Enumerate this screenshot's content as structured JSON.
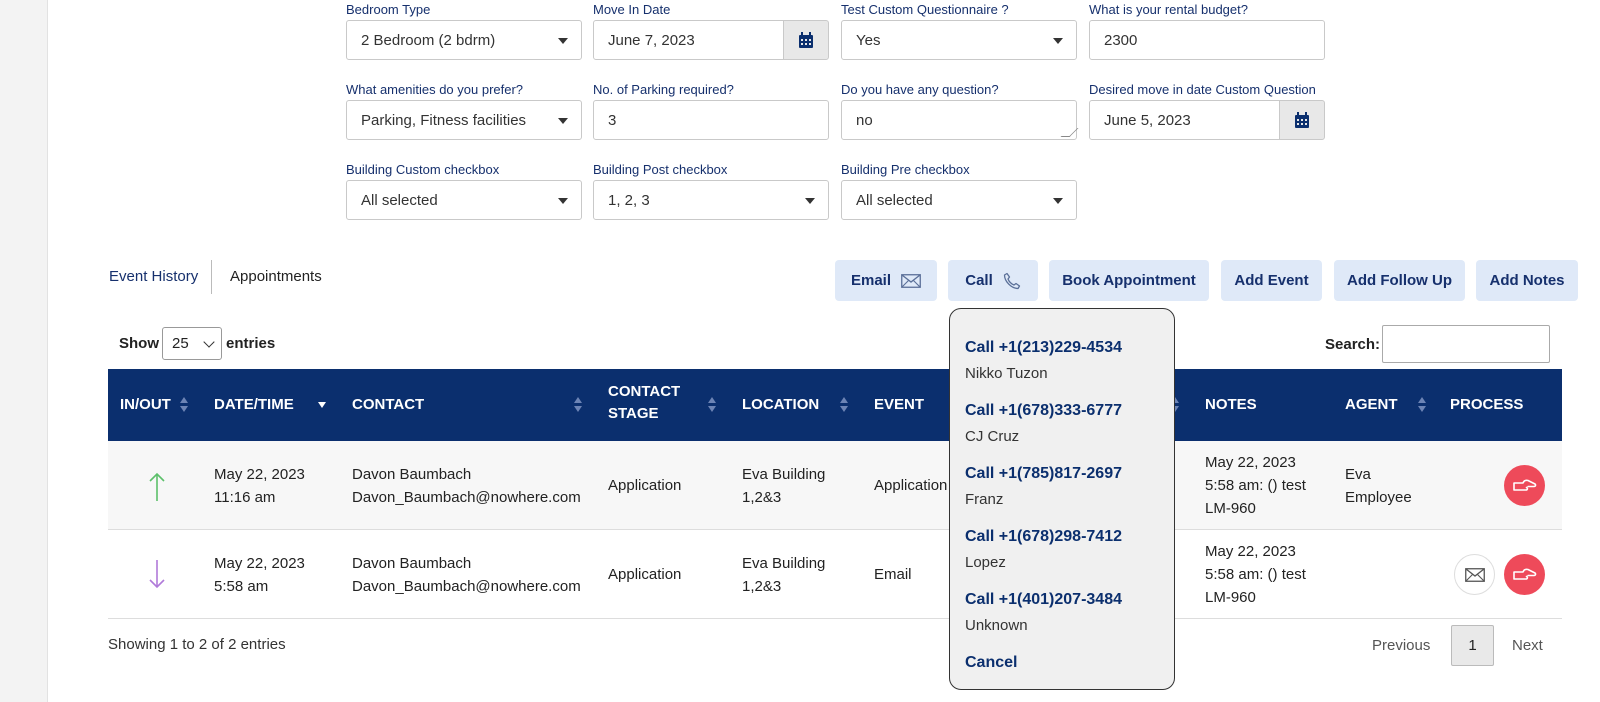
{
  "form": {
    "bedroom_type": {
      "label": "Bedroom Type",
      "value": "2 Bedroom (2 bdrm)"
    },
    "move_in_date": {
      "label": "Move In Date",
      "value": "June 7, 2023"
    },
    "test_questionnaire": {
      "label": "Test Custom Questionnaire ?",
      "value": "Yes"
    },
    "rental_budget": {
      "label": "What is your rental budget?",
      "value": "2300"
    },
    "amenities": {
      "label": "What amenities do you prefer?",
      "value": "Parking, Fitness facilities"
    },
    "parking": {
      "label": "No. of Parking required?",
      "value": "3"
    },
    "question": {
      "label": "Do you have any question?",
      "value": "no"
    },
    "desired_move_in": {
      "label": "Desired move in date Custom Question",
      "value": "June 5, 2023"
    },
    "building_custom": {
      "label": "Building Custom checkbox",
      "value": "All selected"
    },
    "building_post": {
      "label": "Building Post checkbox",
      "value": "1, 2, 3"
    },
    "building_pre": {
      "label": "Building Pre checkbox",
      "value": "All selected"
    }
  },
  "tabs": {
    "event_history": "Event History",
    "appointments": "Appointments"
  },
  "actions": {
    "email": "Email",
    "call": "Call",
    "book_appointment": "Book Appointment",
    "add_event": "Add Event",
    "add_follow_up": "Add Follow Up",
    "add_notes": "Add Notes"
  },
  "table_controls": {
    "show": "Show",
    "entries_value": "25",
    "entries": "entries",
    "search": "Search:"
  },
  "table": {
    "headers": {
      "in_out": "IN/OUT",
      "date_time": "DATE/TIME",
      "contact": "CONTACT",
      "contact_stage_1": "CONTACT",
      "contact_stage_2": "STAGE",
      "location": "LOCATION",
      "event": "EVENT",
      "notes": "NOTES",
      "agent": "AGENT",
      "process": "PROCESS"
    },
    "rows": [
      {
        "direction": "in",
        "date": "May 22, 2023",
        "time": "11:16 am",
        "contact_name": "Davon Baumbach",
        "contact_email": "Davon_Baumbach@nowhere.com",
        "stage": "Application",
        "location_1": "Eva Building",
        "location_2": "1,2&3",
        "event": "Application",
        "notes_1": "May 22, 2023",
        "notes_2": "5:58 am: () test",
        "notes_3": "LM-960",
        "agent_1": "Eva",
        "agent_2": "Employee"
      },
      {
        "direction": "out",
        "date": "May 22, 2023",
        "time": "5:58 am",
        "contact_name": "Davon Baumbach",
        "contact_email": "Davon_Baumbach@nowhere.com",
        "stage": "Application",
        "location_1": "Eva Building",
        "location_2": "1,2&3",
        "event": "Email",
        "notes_1": "May 22, 2023",
        "notes_2": "5:58 am: () test",
        "notes_3": "LM-960",
        "agent_1": "",
        "agent_2": ""
      }
    ]
  },
  "footer": {
    "showing": "Showing 1 to 2 of 2 entries",
    "previous": "Previous",
    "page": "1",
    "next": "Next"
  },
  "call_popup": {
    "items": [
      {
        "number": "Call +1(213)229-4534",
        "name": "Nikko Tuzon"
      },
      {
        "number": "Call +1(678)333-6777",
        "name": "CJ Cruz"
      },
      {
        "number": "Call +1(785)817-2697",
        "name": "Franz"
      },
      {
        "number": "Call +1(678)298-7412",
        "name": "Lopez"
      },
      {
        "number": "Call +1(401)207-3484",
        "name": "Unknown"
      }
    ],
    "cancel": "Cancel"
  },
  "colors": {
    "navy": "#0b2f6e",
    "action_bg": "#dfe9f8",
    "process_red": "#ee4a5a",
    "arrow_in": "#5cc06a",
    "arrow_out": "#b07ad9"
  }
}
